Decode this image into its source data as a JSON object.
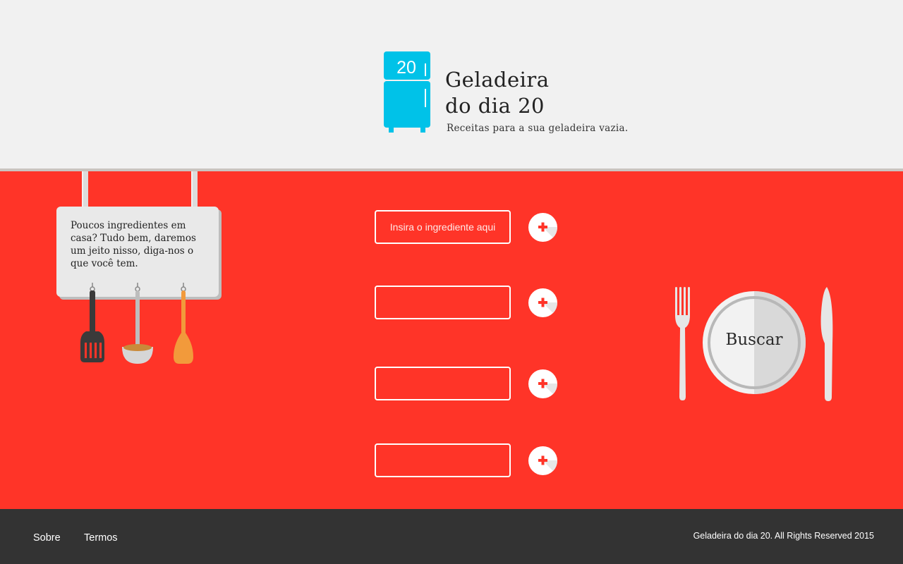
{
  "brand": {
    "logo_number": "20",
    "title_line1": "Geladeira",
    "title_line2": "do dia 20",
    "subtitle": "Receitas para a sua geladeira vazia.",
    "logo_color": "#00c2e8"
  },
  "sign": {
    "text": "Poucos ingredientes em casa? Tudo bem, daremos um jeito nisso, diga-nos o que você tem."
  },
  "ingredients": {
    "placeholder": "Insira o ingrediente aqui",
    "fields": [
      {
        "value": "",
        "placeholder": "Insira o ingrediente aqui"
      },
      {
        "value": "",
        "placeholder": ""
      },
      {
        "value": "",
        "placeholder": ""
      },
      {
        "value": "",
        "placeholder": ""
      }
    ],
    "add_icon": "plus-icon"
  },
  "search": {
    "label": "Buscar"
  },
  "footer": {
    "links": [
      "Sobre",
      "Termos"
    ],
    "copyright": "Geladeira do dia 20. All Rights Reserved 2015"
  },
  "colors": {
    "accent": "#ff3428",
    "header_bg": "#f1f1f1",
    "footer_bg": "#333333",
    "white": "#ffffff"
  }
}
